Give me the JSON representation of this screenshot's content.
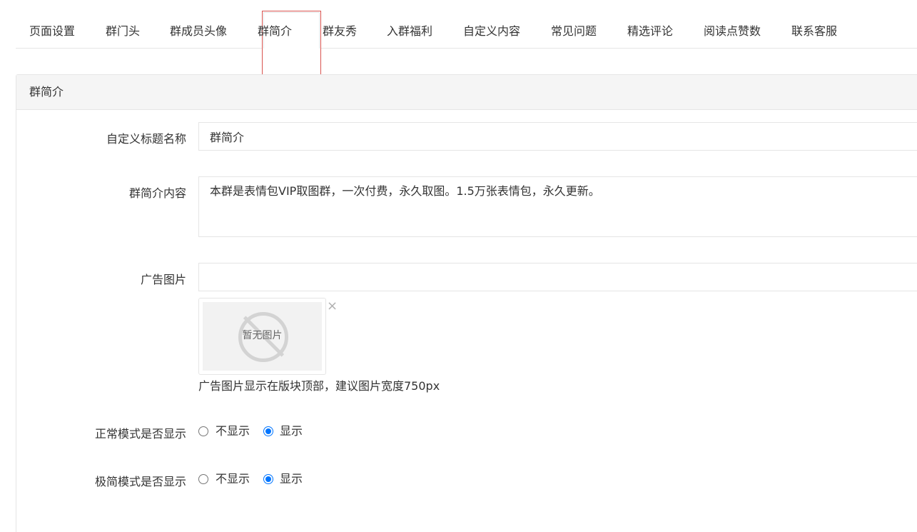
{
  "tabs": [
    {
      "label": "页面设置"
    },
    {
      "label": "群门头"
    },
    {
      "label": "群成员头像"
    },
    {
      "label": "群简介",
      "active": true
    },
    {
      "label": "群友秀"
    },
    {
      "label": "入群福利"
    },
    {
      "label": "自定义内容"
    },
    {
      "label": "常见问题"
    },
    {
      "label": "精选评论"
    },
    {
      "label": "阅读点赞数"
    },
    {
      "label": "联系客服"
    }
  ],
  "panel": {
    "title": "群简介"
  },
  "form": {
    "title_name": {
      "label": "自定义标题名称",
      "value": "群简介"
    },
    "content": {
      "label": "群简介内容",
      "value": "本群是表情包VIP取图群，一次付费，永久取图。1.5万张表情包，永久更新。"
    },
    "ad_image": {
      "label": "广告图片",
      "value": "",
      "placeholder_text": "暂无图片",
      "remove_symbol": "×",
      "hint": "广告图片显示在版块顶部，建议图片宽度750px"
    },
    "normal_mode": {
      "label": "正常模式是否显示",
      "options": [
        "不显示",
        "显示"
      ],
      "selected": "显示"
    },
    "simple_mode": {
      "label": "极简模式是否显示",
      "options": [
        "不显示",
        "显示"
      ],
      "selected": "显示"
    }
  },
  "colors": {
    "accent": "#0075ff",
    "active_tab_outline": "#d9534f",
    "border": "#e5e5e5",
    "panel_header_bg": "#f5f5f5"
  }
}
